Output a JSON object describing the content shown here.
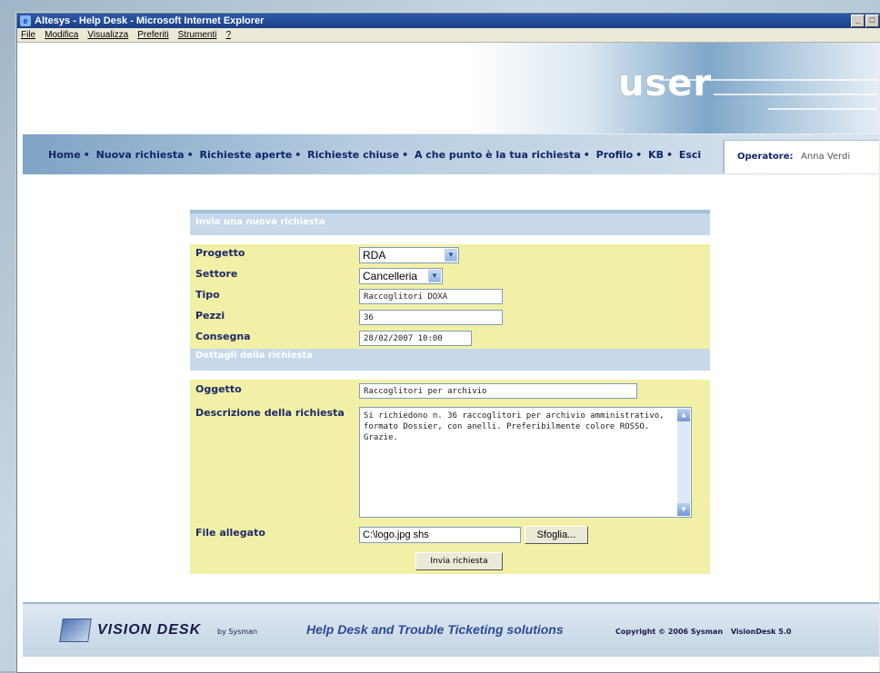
{
  "window": {
    "title": "Altesys - Help Desk - Microsoft Internet Explorer"
  },
  "menu": {
    "items": [
      "File",
      "Modifica",
      "Visualizza",
      "Preferiti",
      "Strumenti",
      "?"
    ]
  },
  "header": {
    "banner_text": "user",
    "nav": [
      "Home",
      "Nuova richiesta",
      "Richieste aperte",
      "Richieste chiuse",
      "A che punto è la tua richiesta",
      "Profilo",
      "KB",
      "Esci"
    ],
    "operator_label": "Operatore:",
    "operator_name": "Anna Verdi"
  },
  "form": {
    "section1_title": "Invia una nuova richiesta",
    "progetto": {
      "label": "Progetto",
      "value": "RDA"
    },
    "settore": {
      "label": "Settore",
      "value": "Cancelleria"
    },
    "tipo": {
      "label": "Tipo",
      "value": "Raccoglitori DOXA"
    },
    "pezzi": {
      "label": "Pezzi",
      "value": "36"
    },
    "consegna": {
      "label": "Consegna",
      "value": "28/02/2007 10:00"
    },
    "section2_title": "Dettagli della richiesta",
    "oggetto": {
      "label": "Oggetto",
      "value": "Raccoglitori per archivio"
    },
    "descrizione": {
      "label": "Descrizione della richiesta",
      "value": "Si richiedono n. 36 raccoglitori per archivio amministrativo, formato Dossier, con anelli. Preferibilmente colore ROSSO. Grazie."
    },
    "file": {
      "label": "File allegato",
      "value": "C:\\logo.jpg shs",
      "browse_label": "Sfoglia..."
    },
    "submit_label": "Invia richiesta"
  },
  "footer": {
    "brand": "VISION DESK",
    "by": "by Sysman",
    "tagline": "Help Desk and Trouble Ticketing solutions",
    "copyright": "Copyright © 2006 Sysman",
    "version": "VisionDesk 5.0"
  },
  "colors": {
    "nav_text": "#12246a",
    "form_bg": "#f2f0a6",
    "section_head": "#c7d8ea"
  }
}
